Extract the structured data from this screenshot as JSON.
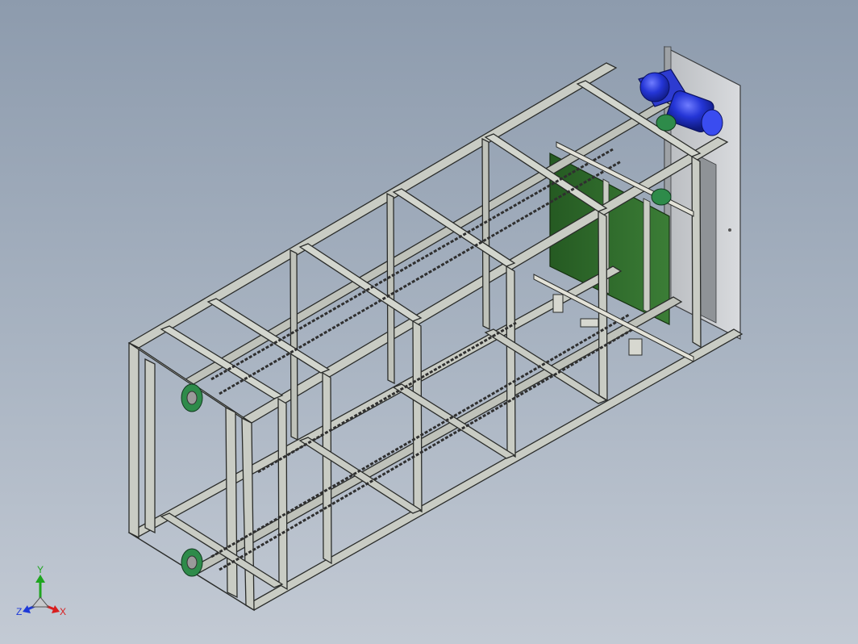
{
  "triad": {
    "x_label": "X",
    "y_label": "Y",
    "z_label": "Z",
    "x_color": "#d81e1e",
    "y_color": "#1ea51e",
    "z_color": "#1e3ad8"
  },
  "colors": {
    "background_top": "#8d9bad",
    "background_bottom": "#c3cad4",
    "frame": "#c9ccc4",
    "frame_edge": "#2a2c2a",
    "conveyor_panel": "#2f6b2b",
    "motor": "#1f2fc8",
    "mount_plate": "#c7c9cc",
    "chain": "#3a3a3a",
    "bearing": "#2e8b4a"
  },
  "model": {
    "description_icon": "cad-frame-model",
    "components": [
      "steel-frame",
      "drive-motor",
      "gearbox",
      "chain-conveyor",
      "green-panel",
      "mounting-plate",
      "bearing-units"
    ]
  }
}
